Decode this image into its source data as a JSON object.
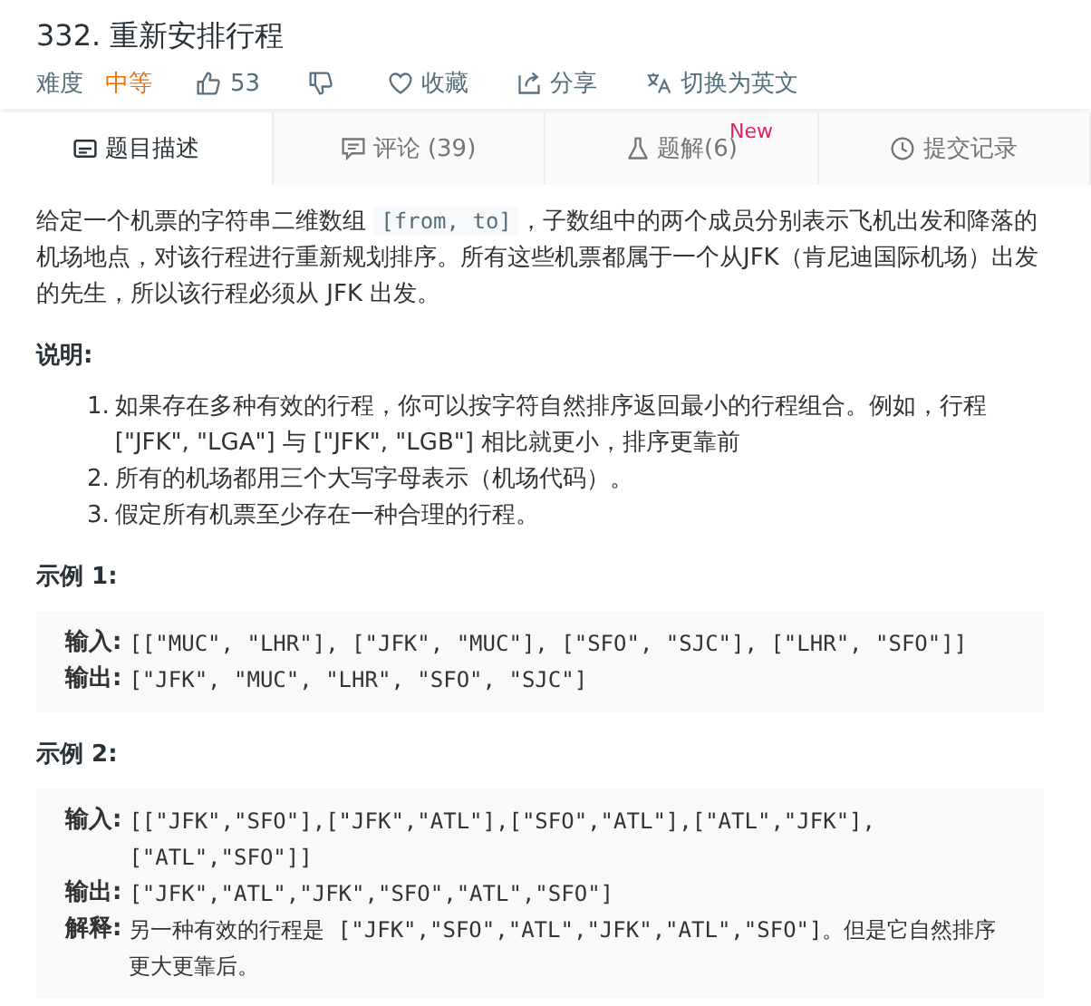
{
  "title": "332. 重新安排行程",
  "meta": {
    "difficulty_label": "难度",
    "difficulty": "中等",
    "likes": "53",
    "favorite": "收藏",
    "share": "分享",
    "switch_language": "切换为英文"
  },
  "tabs": [
    {
      "label": "题目描述",
      "kind": "description",
      "selected": true
    },
    {
      "label": "评论 (39)",
      "kind": "comments",
      "selected": false
    },
    {
      "label": "题解(6)",
      "kind": "solutions",
      "selected": false,
      "badge": "New"
    },
    {
      "label": "提交记录",
      "kind": "submissions",
      "selected": false
    }
  ],
  "description": {
    "before": "给定一个机票的字符串二维数组 ",
    "code": "[from, to]",
    "after": "，子数组中的两个成员分别表示飞机出发和降落的机场地点，对该行程进行重新规划排序。所有这些机票都属于一个从JFK（肯尼迪国际机场）出发的先生，所以该行程必须从 JFK 出发。"
  },
  "notes_heading": "说明:",
  "notes": [
    {
      "number": "1.",
      "text": "如果存在多种有效的行程，你可以按字符自然排序返回最小的行程组合。例如，行程 [\"JFK\", \"LGA\"] 与 [\"JFK\", \"LGB\"] 相比就更小，排序更靠前"
    },
    {
      "number": "2.",
      "text": "所有的机场都用三个大写字母表示（机场代码）。"
    },
    {
      "number": "3.",
      "text": "假定所有机票至少存在一种合理的行程。"
    }
  ],
  "examples": [
    {
      "heading": "示例 1:",
      "lines": [
        {
          "label": "输入:",
          "value": "[[\"MUC\", \"LHR\"], [\"JFK\", \"MUC\"], [\"SFO\", \"SJC\"], [\"LHR\", \"SFO\"]]"
        },
        {
          "label": "输出:",
          "value": "[\"JFK\", \"MUC\", \"LHR\", \"SFO\", \"SJC\"]"
        }
      ]
    },
    {
      "heading": "示例 2:",
      "lines": [
        {
          "label": "输入:",
          "value": "[[\"JFK\",\"SFO\"],[\"JFK\",\"ATL\"],[\"SFO\",\"ATL\"],[\"ATL\",\"JFK\"],\n[\"ATL\",\"SFO\"]]"
        },
        {
          "label": "输出:",
          "value": "[\"JFK\",\"ATL\",\"JFK\",\"SFO\",\"ATL\",\"SFO\"]"
        },
        {
          "label": "解释:",
          "value": "另一种有效的行程是 [\"JFK\",\"SFO\",\"ATL\",\"JFK\",\"ATL\",\"SFO\"]。但是它自然排序更大更靠后。"
        }
      ]
    }
  ]
}
